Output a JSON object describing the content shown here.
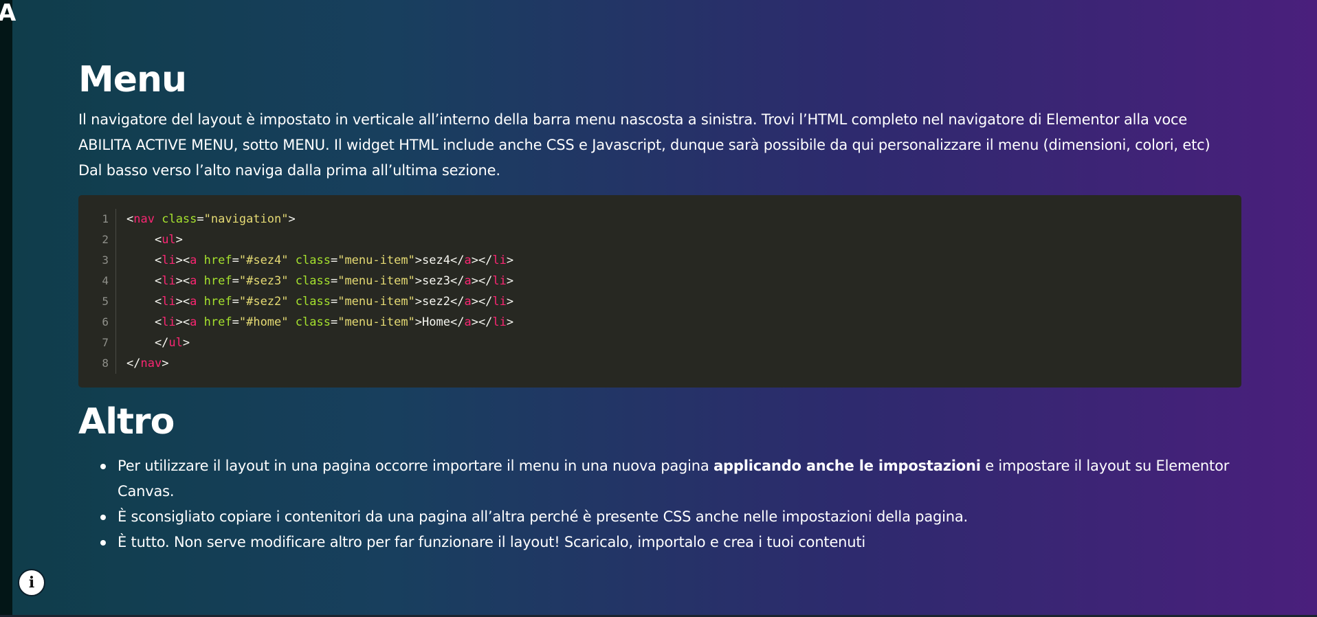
{
  "corner_letter": "A",
  "section_menu": {
    "title": "Menu",
    "intro_lines": [
      "Il navigatore del layout è impostato in verticale all’interno della barra menu nascosta a sinistra. Trovi l’HTML completo nel navigatore di Elementor alla voce",
      "ABILITA ACTIVE MENU, sotto MENU. Il widget HTML include anche CSS e Javascript, dunque sarà possibile da qui personalizzare il menu (dimensioni, colori, etc)",
      "Dal basso verso l’alto naviga dalla prima all’ultima sezione."
    ]
  },
  "code": {
    "line_numbers": [
      "1",
      "2",
      "3",
      "4",
      "5",
      "6",
      "7",
      "8"
    ],
    "tokens": {
      "l1": [
        "<",
        "nav",
        " ",
        "class",
        "=",
        "\"navigation\"",
        ">"
      ],
      "l2": [
        "    <",
        "ul",
        ">"
      ],
      "l3": [
        "    <",
        "li",
        "><",
        "a",
        " ",
        "href",
        "=",
        "\"#sez4\"",
        " ",
        "class",
        "=",
        "\"menu-item\"",
        ">sez4</",
        "a",
        "></",
        "li",
        ">"
      ],
      "l4": [
        "    <",
        "li",
        "><",
        "a",
        " ",
        "href",
        "=",
        "\"#sez3\"",
        " ",
        "class",
        "=",
        "\"menu-item\"",
        ">sez3</",
        "a",
        "></",
        "li",
        ">"
      ],
      "l5": [
        "    <",
        "li",
        "><",
        "a",
        " ",
        "href",
        "=",
        "\"#sez2\"",
        " ",
        "class",
        "=",
        "\"menu-item\"",
        ">sez2</",
        "a",
        "></",
        "li",
        ">"
      ],
      "l6": [
        "    <",
        "li",
        "><",
        "a",
        " ",
        "href",
        "=",
        "\"#home\"",
        " ",
        "class",
        "=",
        "\"menu-item\"",
        ">Home</",
        "a",
        "></",
        "li",
        ">"
      ],
      "l7": [
        "    </",
        "ul",
        ">"
      ],
      "l8": [
        "</",
        "nav",
        ">"
      ]
    }
  },
  "section_altro": {
    "title": "Altro",
    "items": [
      {
        "before": "Per utilizzare il layout in una pagina occorre importare il menu in una nuova pagina ",
        "bold": "applicando anche le impostazioni",
        "after": " e impostare il layout su Elementor Canvas."
      },
      {
        "text": "È sconsigliato copiare i contenitori da una pagina all’altra perché è presente CSS anche nelle impostazioni della pagina."
      },
      {
        "text": "È tutto. Non serve modificare altro per far funzionare il layout! Scaricalo, importalo e crea i tuoi contenuti"
      }
    ]
  },
  "info_button": {
    "icon": "info-icon",
    "glyph": "i"
  },
  "colors": {
    "code_bg": "#272822",
    "tag": "#f92672",
    "attr": "#a6e22e",
    "string": "#e6db74",
    "gradient_start": "#0f3d4a",
    "gradient_end": "#4a1f7c"
  }
}
